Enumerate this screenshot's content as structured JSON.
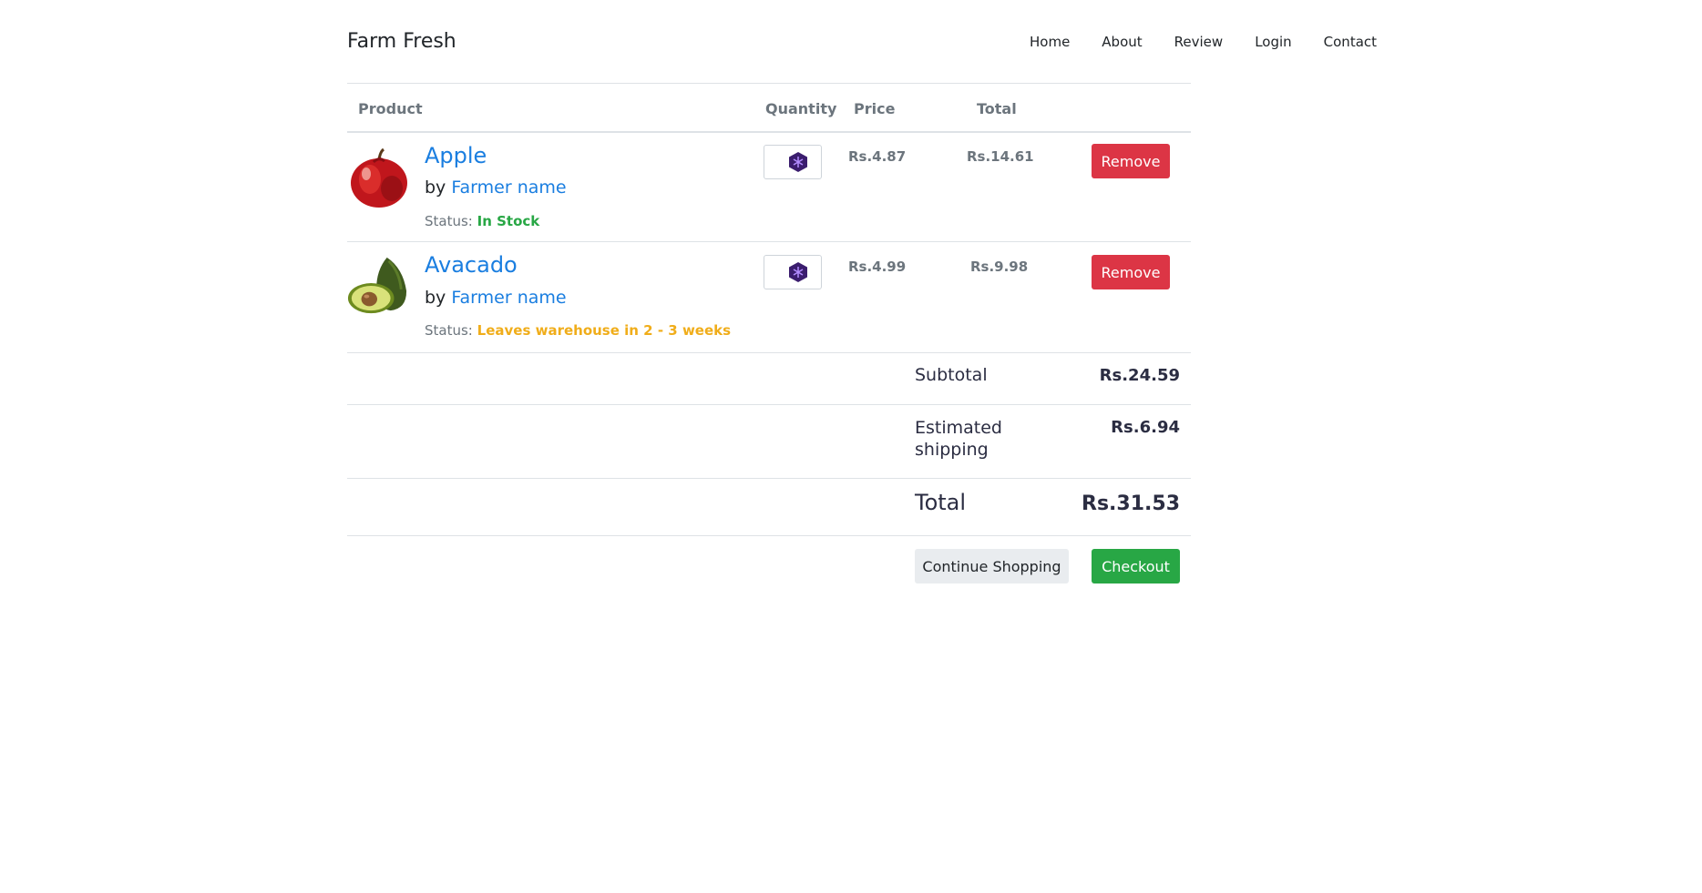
{
  "navbar": {
    "brand": "Farm Fresh",
    "links": [
      "Home",
      "About",
      "Review",
      "Login",
      "Contact"
    ]
  },
  "table": {
    "headers": {
      "product": "Product",
      "quantity": "Quantity",
      "price": "Price",
      "total": "Total"
    },
    "items": [
      {
        "name": "Apple",
        "by": "by",
        "farmer": "Farmer name",
        "status_label": "Status:",
        "status": "In Stock",
        "status_color": "#28a745",
        "price": "Rs.4.87",
        "total": "Rs.14.61",
        "remove_label": "Remove",
        "image_icon": "apple-image"
      },
      {
        "name": "Avacado",
        "by": "by",
        "farmer": "Farmer name",
        "status_label": "Status:",
        "status": "Leaves warehouse in 2 - 3 weeks",
        "status_color": "#f0ad1a",
        "price": "Rs.4.99",
        "total": "Rs.9.98",
        "remove_label": "Remove",
        "image_icon": "avocado-image"
      }
    ]
  },
  "summary": {
    "subtotal_label": "Subtotal",
    "subtotal_value": "Rs.24.59",
    "shipping_label_1": "Estimated",
    "shipping_label_2": "shipping",
    "shipping_value": "Rs.6.94",
    "total_label": "Total",
    "total_value": "Rs.31.53"
  },
  "actions": {
    "continue_label": "Continue Shopping",
    "checkout_label": "Checkout"
  },
  "colors": {
    "link_blue": "#1a7ee0",
    "remove_red": "#dc3545",
    "checkout_green": "#28a745",
    "summary_navy": "#2b2d42"
  }
}
